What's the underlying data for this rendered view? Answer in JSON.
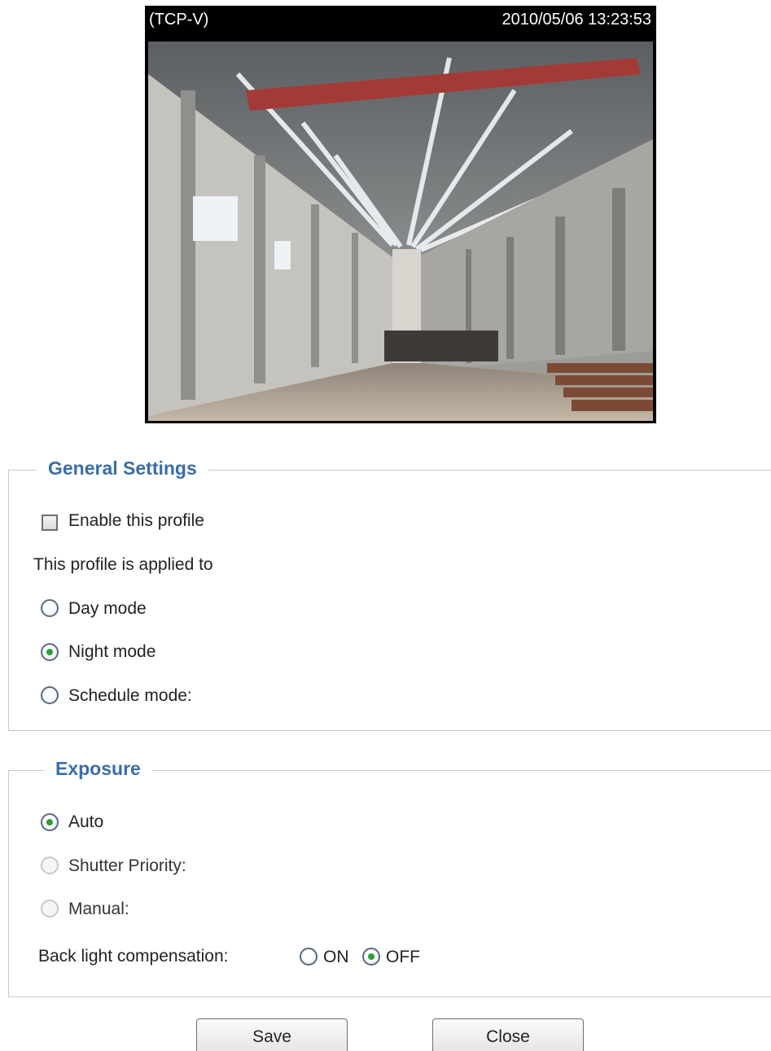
{
  "preview": {
    "overlay_left": "(TCP-V)",
    "overlay_right": "2010/05/06 13:23:53"
  },
  "general": {
    "title": "General Settings",
    "enable_label": "Enable this profile",
    "enable_checked": false,
    "applied_label": "This profile is applied to",
    "modes": [
      {
        "label": "Day mode",
        "checked": false
      },
      {
        "label": "Night mode",
        "checked": true
      },
      {
        "label": "Schedule mode:",
        "checked": false
      }
    ]
  },
  "exposure": {
    "title": "Exposure",
    "options": [
      {
        "label": "Auto",
        "checked": true,
        "enabled": true
      },
      {
        "label": "Shutter Priority:",
        "checked": false,
        "enabled": false
      },
      {
        "label": "Manual:",
        "checked": false,
        "enabled": false
      }
    ],
    "blc_label": "Back light compensation:",
    "blc_on_label": "ON",
    "blc_off_label": "OFF",
    "blc_selected": "OFF"
  },
  "buttons": {
    "save_label": "Save",
    "close_label": "Close"
  },
  "colors": {
    "group_title": "#3a6ea5",
    "radio_selected": "#2f9c3a"
  }
}
